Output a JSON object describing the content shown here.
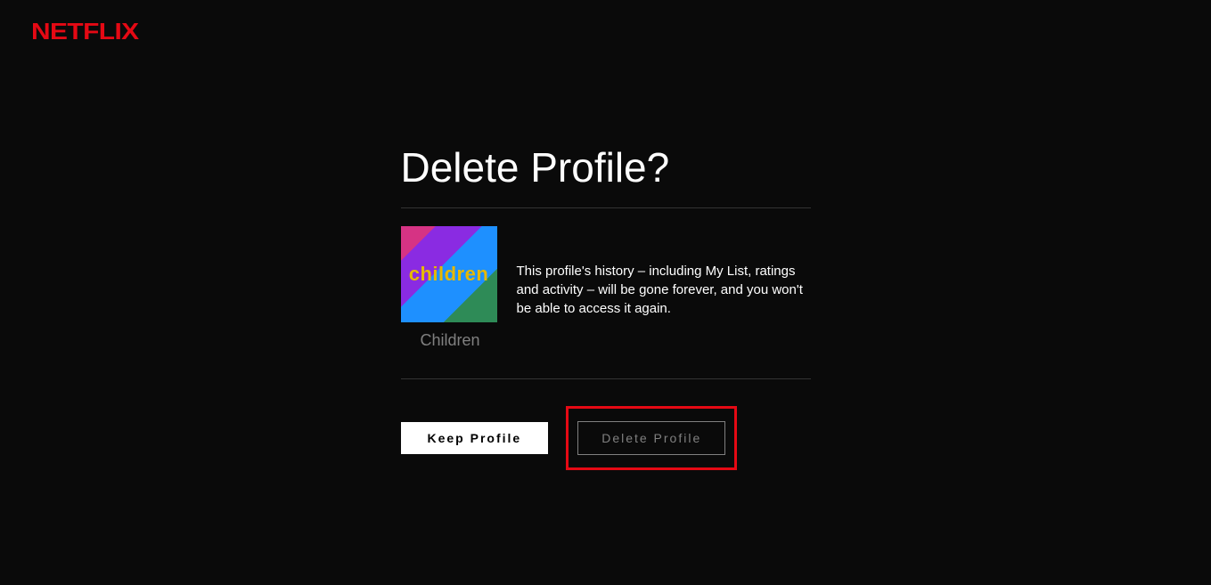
{
  "brand": {
    "name": "NETFLIX"
  },
  "dialog": {
    "title": "Delete Profile?",
    "warning": "This profile's history – including My List, ratings and activity – will be gone forever, and you won't be able to access it again."
  },
  "profile": {
    "name": "Children",
    "avatar_label": "children"
  },
  "buttons": {
    "keep": "Keep Profile",
    "delete": "Delete Profile"
  }
}
